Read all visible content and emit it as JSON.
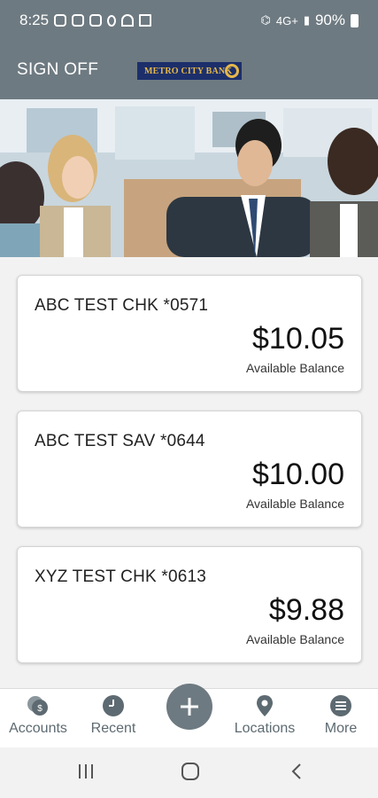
{
  "status_bar": {
    "time": "8:25",
    "battery": "90%",
    "network": "4G+"
  },
  "header": {
    "sign_off_label": "SIGN OFF",
    "logo_text": "METRO CITY BANK"
  },
  "accounts": [
    {
      "name": "ABC TEST CHK *0571",
      "balance": "$10.05",
      "balance_label": "Available Balance"
    },
    {
      "name": "ABC TEST SAV *0644",
      "balance": "$10.00",
      "balance_label": "Available Balance"
    },
    {
      "name": "XYZ TEST CHK *0613",
      "balance": "$9.88",
      "balance_label": "Available Balance"
    }
  ],
  "bottom_nav": {
    "accounts": "Accounts",
    "recent": "Recent",
    "add": "add-icon",
    "locations": "Locations",
    "more": "More"
  },
  "colors": {
    "header": "#6e7a81",
    "brand_navy": "#1c2f6b",
    "brand_gold": "#e6b84a",
    "nav_icon": "#5d6a71"
  }
}
